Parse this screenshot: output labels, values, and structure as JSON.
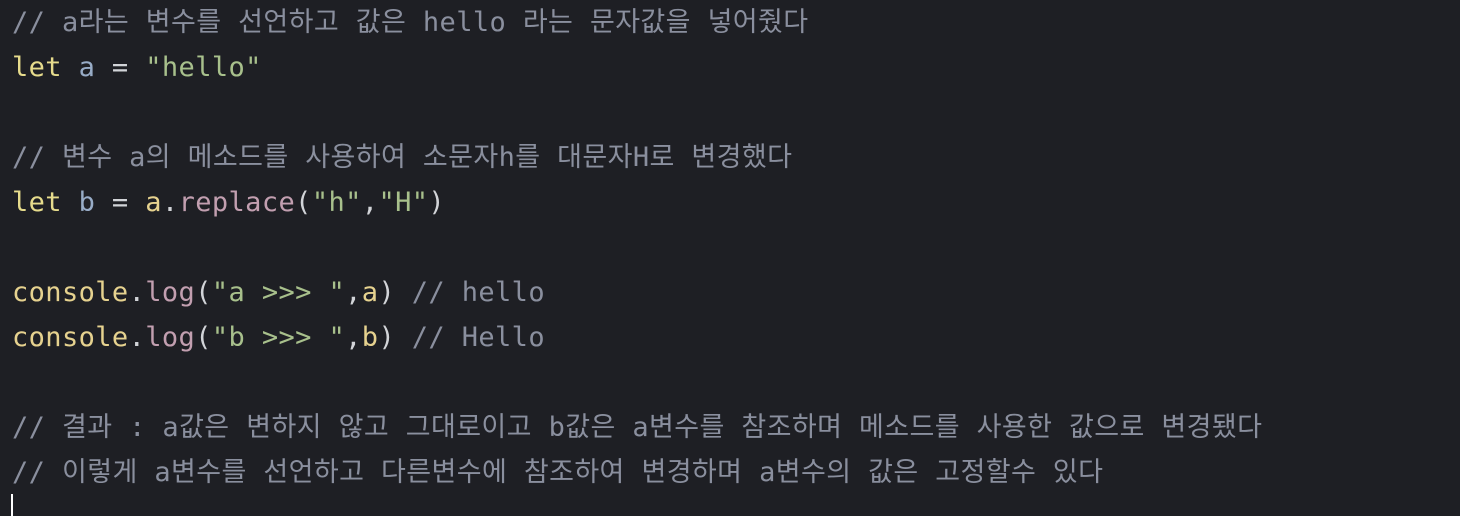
{
  "colors": {
    "background": "#1e1f24",
    "comment": "#8a8f9e",
    "keyword": "#e6db8c",
    "variable": "#98acc7",
    "operator": "#d2d4d8",
    "string": "#a8c08c",
    "object": "#e6d28f",
    "method": "#c29fb0",
    "punctuation": "#d2d4d8",
    "cursor": "#ffffff"
  },
  "lines": [
    [
      {
        "text": "// a라는 변수를 선언하고 값은 hello 라는 문자값을 넣어줬다",
        "type": "comment"
      }
    ],
    [
      {
        "text": "let",
        "type": "keyword"
      },
      {
        "text": " ",
        "type": "punctuation"
      },
      {
        "text": "a",
        "type": "variable"
      },
      {
        "text": " = ",
        "type": "operator"
      },
      {
        "text": "\"hello\"",
        "type": "string"
      }
    ],
    [],
    [
      {
        "text": "// 변수 a의 메소드를 사용하여 소문자h를 대문자H로 변경했다",
        "type": "comment"
      }
    ],
    [
      {
        "text": "let",
        "type": "keyword"
      },
      {
        "text": " ",
        "type": "punctuation"
      },
      {
        "text": "b",
        "type": "variable"
      },
      {
        "text": " = ",
        "type": "operator"
      },
      {
        "text": "a",
        "type": "object"
      },
      {
        "text": ".",
        "type": "punctuation"
      },
      {
        "text": "replace",
        "type": "method"
      },
      {
        "text": "(",
        "type": "punctuation"
      },
      {
        "text": "\"h\"",
        "type": "string"
      },
      {
        "text": ",",
        "type": "punctuation"
      },
      {
        "text": "\"H\"",
        "type": "string"
      },
      {
        "text": ")",
        "type": "punctuation"
      }
    ],
    [],
    [
      {
        "text": "console",
        "type": "object"
      },
      {
        "text": ".",
        "type": "punctuation"
      },
      {
        "text": "log",
        "type": "method"
      },
      {
        "text": "(",
        "type": "punctuation"
      },
      {
        "text": "\"a >>> \"",
        "type": "string"
      },
      {
        "text": ",",
        "type": "punctuation"
      },
      {
        "text": "a",
        "type": "object"
      },
      {
        "text": ")",
        "type": "punctuation"
      },
      {
        "text": " // hello",
        "type": "comment"
      }
    ],
    [
      {
        "text": "console",
        "type": "object"
      },
      {
        "text": ".",
        "type": "punctuation"
      },
      {
        "text": "log",
        "type": "method"
      },
      {
        "text": "(",
        "type": "punctuation"
      },
      {
        "text": "\"b >>> \"",
        "type": "string"
      },
      {
        "text": ",",
        "type": "punctuation"
      },
      {
        "text": "b",
        "type": "object"
      },
      {
        "text": ")",
        "type": "punctuation"
      },
      {
        "text": " // Hello",
        "type": "comment"
      }
    ],
    [],
    [
      {
        "text": "// 결과 : a값은 변하지 않고 그대로이고 b값은 a변수를 참조하며 메소드를 사용한 값으로 변경됐다",
        "type": "comment"
      }
    ],
    [
      {
        "text": "// 이렇게 a변수를 선언하고 다른변수에 참조하여 변경하며 a변수의 값은 고정할수 있다",
        "type": "comment"
      }
    ]
  ]
}
